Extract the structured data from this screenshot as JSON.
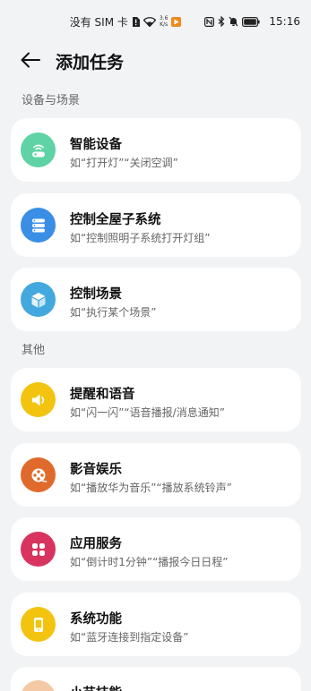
{
  "status_bar": {
    "carrier": "没有 SIM 卡",
    "net_speed_value": "3.6",
    "net_speed_unit": "K/s",
    "time": "15:16"
  },
  "header": {
    "title": "添加任务"
  },
  "sections": {
    "devices_title": "设备与场景",
    "other_title": "其他"
  },
  "items": [
    {
      "title": "智能设备",
      "subtitle": "如“打开灯”“关闭空调”",
      "icon": "smart-device-icon",
      "color": "#5fd3a5"
    },
    {
      "title": "控制全屋子系统",
      "subtitle": "如“控制照明子系统打开灯组”",
      "icon": "stack-icon",
      "color": "#3a8ee6"
    },
    {
      "title": "控制场景",
      "subtitle": "如“执行某个场景”",
      "icon": "cube-icon",
      "color": "#43a8de"
    },
    {
      "title": "提醒和语音",
      "subtitle": "如“闪一闪”“语音播报/消息通知”",
      "icon": "speaker-icon",
      "color": "#f2c40f"
    },
    {
      "title": "影音娱乐",
      "subtitle": "如“播放华为音乐”“播放系统铃声”",
      "icon": "film-reel-icon",
      "color": "#e06a2b"
    },
    {
      "title": "应用服务",
      "subtitle": "如“倒计时1分钟”“播报今日日程”",
      "icon": "app-grid-icon",
      "color": "#d9345f"
    },
    {
      "title": "系统功能",
      "subtitle": "如“蓝牙连接到指定设备”",
      "icon": "phone-icon",
      "color": "#f2c40f"
    },
    {
      "title": "小艺技能",
      "subtitle": "",
      "icon": "xiaoyi-icon",
      "color": "#f3c9a6"
    }
  ]
}
